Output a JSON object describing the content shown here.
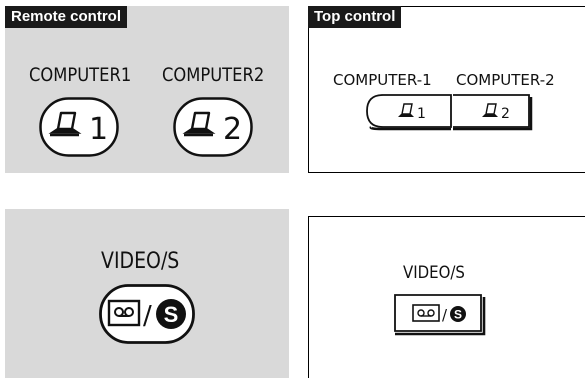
{
  "remote_panel": {
    "title": "Remote control",
    "computer1_label": "COMPUTER1",
    "computer2_label": "COMPUTER2",
    "button1_number": "1",
    "button2_number": "2",
    "background": "#d9d9d9"
  },
  "top_panel": {
    "title": "Top control",
    "computer1_label": "COMPUTER-1",
    "computer2_label": "COMPUTER-2",
    "button1_number": "1",
    "button2_number": "2"
  },
  "remote_video_panel": {
    "label": "VIDEO/S",
    "slash": "/",
    "s_letter": "S",
    "background": "#d9d9d9"
  },
  "top_video_panel": {
    "label": "VIDEO/S",
    "slash": "/",
    "s_letter": "S"
  },
  "icons": {
    "computer": "laptop-icon",
    "video": "videocassette-icon",
    "svideo": "s-circle-icon"
  },
  "colors": {
    "panel_gray": "#d9d9d9",
    "tag_bg": "#1a1a1a",
    "tag_text": "#ffffff"
  }
}
